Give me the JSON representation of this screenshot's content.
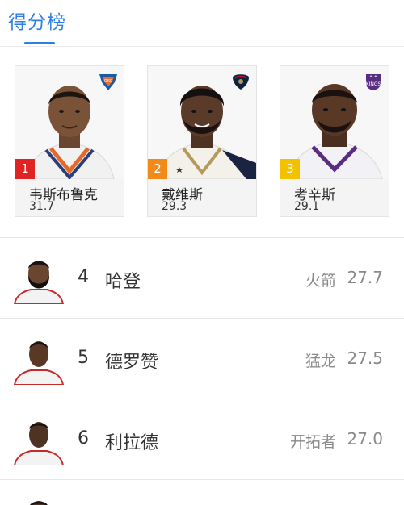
{
  "header": {
    "title": "得分榜"
  },
  "colors": {
    "accent": "#2d7fe0",
    "rank1": "#e02323",
    "rank2": "#f28a1a",
    "rank3": "#f2c200"
  },
  "top3": [
    {
      "rank": "1",
      "name": "韦斯布鲁克",
      "score": "31.7",
      "team_logo": "thunder-logo-icon"
    },
    {
      "rank": "2",
      "name": "戴维斯",
      "score": "29.3",
      "team_logo": "pelicans-logo-icon"
    },
    {
      "rank": "3",
      "name": "考辛斯",
      "score": "29.1",
      "team_logo": "kings-logo-icon"
    }
  ],
  "list": [
    {
      "rank": "4",
      "name": "哈登",
      "team": "火箭",
      "score": "27.7"
    },
    {
      "rank": "5",
      "name": "德罗赞",
      "team": "猛龙",
      "score": "27.5"
    },
    {
      "rank": "6",
      "name": "利拉德",
      "team": "开拓者",
      "score": "27.0"
    }
  ]
}
